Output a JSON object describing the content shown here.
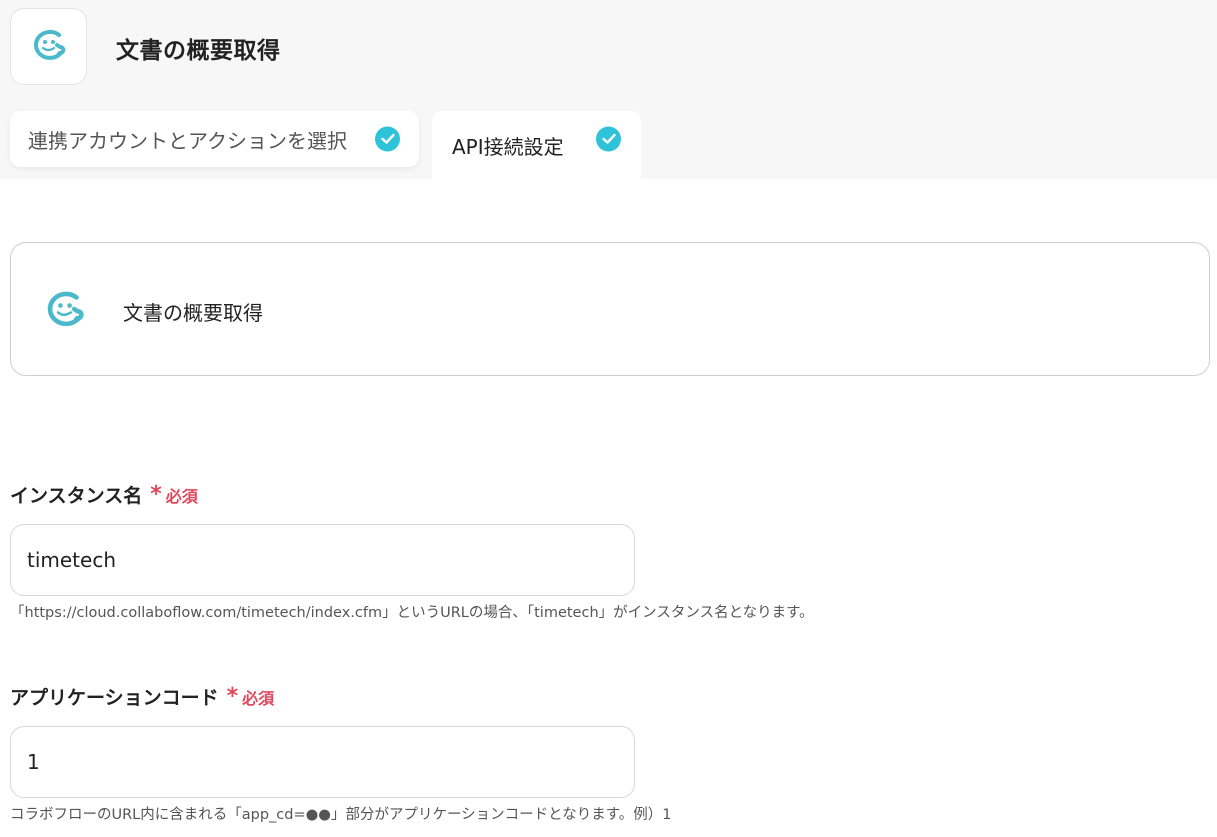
{
  "header": {
    "title": "文書の概要取得",
    "app_icon": "collaboflow-logo-icon"
  },
  "tabs": [
    {
      "label": "連携アカウントとアクションを選択",
      "completed": true,
      "active": false
    },
    {
      "label": "API接続設定",
      "completed": true,
      "active": true
    }
  ],
  "action_card": {
    "title": "文書の概要取得",
    "icon": "collaboflow-logo-icon"
  },
  "fields": [
    {
      "label": "インスタンス名",
      "required_mark": "*",
      "required_text": "必須",
      "value": "timetech",
      "help": "「https://cloud.collaboflow.com/timetech/index.cfm」というURLの場合、「timetech」がインスタンス名となります。"
    },
    {
      "label": "アプリケーションコード",
      "required_mark": "*",
      "required_text": "必須",
      "value": "1",
      "help": "コラボフローのURL内に含まれる「app_cd=●●」部分がアプリケーションコードとなります。例）1"
    }
  ],
  "colors": {
    "accent": "#2ec3d8",
    "required": "#e0485d",
    "logo": "#4ab9cc"
  }
}
